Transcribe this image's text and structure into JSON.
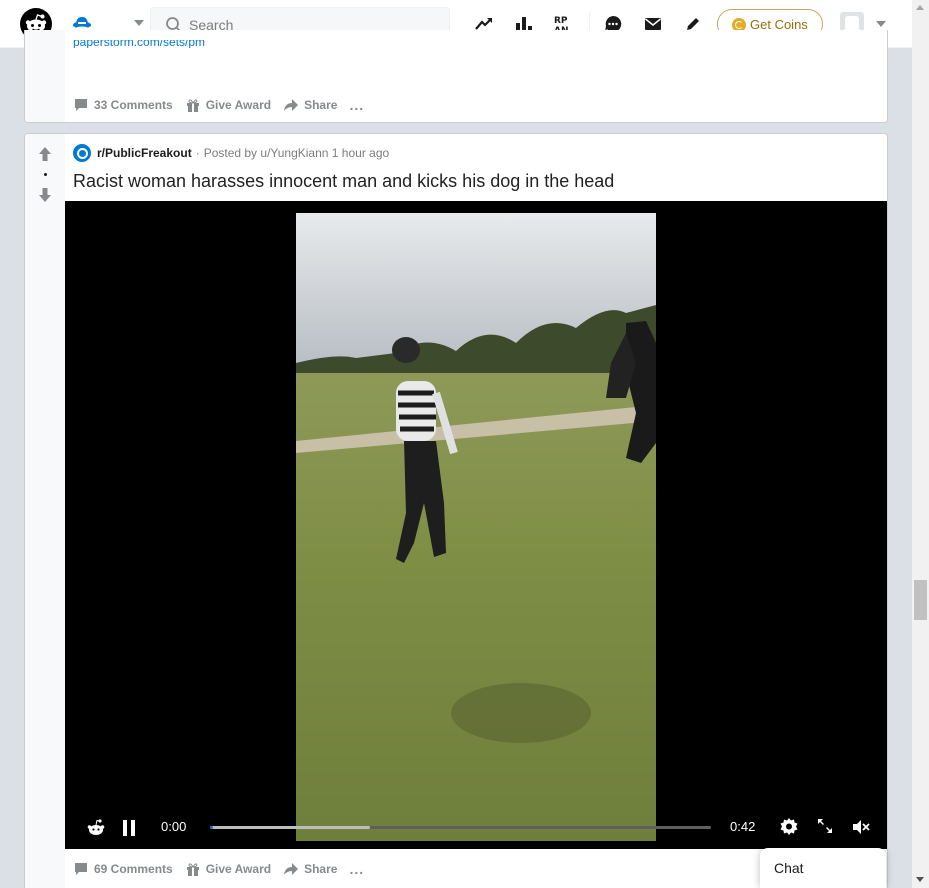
{
  "header": {
    "search": {
      "placeholder": "Search",
      "value": ""
    },
    "get_coins_label": "Get Coins",
    "icons": [
      "reddit-logo",
      "home-icon",
      "trending-icon",
      "leaderboard-icon",
      "rpan-icon",
      "chat-icon",
      "mail-icon",
      "create-post-icon",
      "coin-icon",
      "avatar"
    ]
  },
  "posts": [
    {
      "link_fragment": "paperstorm.com/sets/pm",
      "comments_label": "33 Comments",
      "award_label": "Give Award",
      "share_label": "Share",
      "more_label": "..."
    },
    {
      "subreddit": "r/PublicFreakout",
      "meta_dot": "·",
      "posted_by": "Posted by u/YungKiann 1 hour ago",
      "title": "Racist woman harasses innocent man and kicks his dog in the head",
      "video": {
        "current_time": "0:00",
        "duration": "0:42",
        "played_fraction": 0.005,
        "buffered_fraction": 0.32,
        "state": "playing",
        "muted": true
      },
      "comments_label": "69 Comments",
      "award_label": "Give Award",
      "share_label": "Share",
      "more_label": "..."
    }
  ],
  "chat": {
    "label": "Chat"
  },
  "colors": {
    "accent": "#0079d3",
    "coin": "#e4ab24",
    "text_muted": "#878a8c"
  }
}
